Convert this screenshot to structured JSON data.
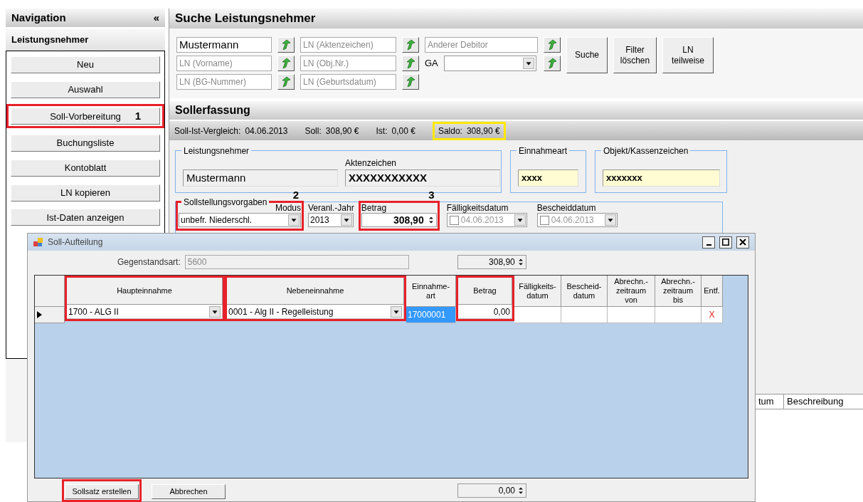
{
  "navigation": {
    "title": "Navigation",
    "collapse": "«",
    "section": "Leistungsnehmer",
    "items": [
      {
        "label": "Neu"
      },
      {
        "label": "Auswahl"
      },
      {
        "label": "Soll-Vorbereitung",
        "highlighted": true,
        "callout": "1"
      },
      {
        "label": "Buchungsliste"
      },
      {
        "label": "Kontoblatt"
      },
      {
        "label": "LN kopieren"
      },
      {
        "label": "Ist-Daten anzeigen"
      }
    ]
  },
  "search": {
    "title": "Suche Leistungsnehmer",
    "rows": [
      [
        {
          "kind": "text",
          "value": "Mustermann"
        },
        {
          "kind": "text",
          "placeholder": "LN (Aktenzeichen)"
        },
        {
          "kind": "text",
          "placeholder": "Anderer Debitor"
        }
      ],
      [
        {
          "kind": "text",
          "placeholder": "LN (Vorname)"
        },
        {
          "kind": "text",
          "placeholder": "LN (Obj.Nr.)"
        },
        {
          "kind": "combo",
          "label": "GA"
        }
      ],
      [
        {
          "kind": "text",
          "placeholder": "LN (BG-Nummer)"
        },
        {
          "kind": "text",
          "placeholder": "LN (Geburtsdatum)"
        }
      ]
    ],
    "buttons": [
      "Suche",
      "Filter löschen",
      "LN teilweise"
    ]
  },
  "entry": {
    "title": "Sollerfassung",
    "status": [
      {
        "label": "Soll-Ist-Vergleich:",
        "value": "04.06.2013"
      },
      {
        "label": "Soll:",
        "value": "308,90 €"
      },
      {
        "label": "Ist:",
        "value": "0,00 €"
      },
      {
        "label": "Saldo:",
        "value": "308,90 €",
        "highlighted": true
      }
    ],
    "groups": [
      {
        "legend": "Leistungsnehmer",
        "fields": [
          {
            "kind": "readonly",
            "value": "Mustermann"
          },
          {
            "kind": "readonly",
            "label": "Aktenzeichen",
            "value": "XXXXXXXXXXX"
          }
        ]
      },
      {
        "legend": "Einnahmeart",
        "fields": [
          {
            "kind": "mandatory",
            "value": "xxxx"
          }
        ]
      },
      {
        "legend": "Objekt/Kassenzeichen",
        "fields": [
          {
            "kind": "mandatory",
            "value": "xxxxxxx"
          }
        ]
      }
    ],
    "defaults": {
      "legend": "Sollstellungsvorgaben",
      "controls": [
        {
          "kind": "combo",
          "label": "Modus",
          "value": "unbefr. Niederschl.",
          "highlighted": true,
          "callout": "2"
        },
        {
          "kind": "combo",
          "label": "Veranl.-Jahr",
          "value": "2013"
        },
        {
          "kind": "spinner",
          "label": "Betrag",
          "value": "308,90",
          "highlighted": true,
          "callout": "3"
        },
        {
          "kind": "date",
          "label": "Fälligkeitsdatum",
          "value": "04.06.2013",
          "checked": false
        },
        {
          "kind": "date",
          "label": "Bescheiddatum",
          "value": "04.06.2013",
          "checked": false
        }
      ]
    },
    "list_columns": [
      "tum",
      "Beschreibung"
    ]
  },
  "dialog": {
    "title": "Soll-Aufteilung",
    "subject_label": "Gegenstandsart:",
    "subject_value": "5600",
    "total": "308,90",
    "columns": [
      {
        "label": "Haupteinnahme",
        "highlighted": true
      },
      {
        "label": "Nebeneinnahme",
        "highlighted": true
      },
      {
        "label": "Einnahme-art"
      },
      {
        "label": "Betrag",
        "highlighted": true
      },
      {
        "label": "Fälligkeits-datum"
      },
      {
        "label": "Bescheid-datum"
      },
      {
        "label": "Abrechn.-zeitraum von"
      },
      {
        "label": "Abrechn.-zeitraum bis"
      },
      {
        "label": "Entf."
      }
    ],
    "rows": [
      {
        "current": true,
        "cells": [
          {
            "kind": "combo",
            "value": "1700 - ALG II",
            "selected": false
          },
          {
            "kind": "combo",
            "value": "0001 - Alg II - Regelleistung",
            "selected": false
          },
          {
            "kind": "text",
            "value": "17000001",
            "selected": true
          },
          {
            "kind": "number",
            "value": "0,00",
            "selected": false
          },
          {
            "kind": "text",
            "selected": false
          },
          {
            "kind": "text",
            "selected": false
          },
          {
            "kind": "text",
            "selected": false
          },
          {
            "kind": "text",
            "selected": false
          },
          {
            "kind": "delete",
            "value": "X",
            "selected": false
          }
        ]
      }
    ],
    "buttons": [
      {
        "label": "Sollsatz erstellen",
        "highlighted": true
      },
      {
        "label": "Abbrechen"
      }
    ],
    "sum": "0,00"
  }
}
